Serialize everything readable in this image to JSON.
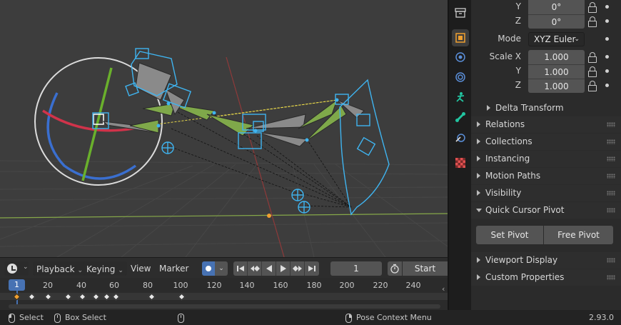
{
  "timeline": {
    "menus": {
      "playback": "Playback",
      "keying": "Keying",
      "view": "View",
      "marker": "Marker"
    },
    "current_frame": "1",
    "start_label": "Start",
    "frame_badge": "1",
    "ticks": [
      "20",
      "40",
      "60",
      "80",
      "100",
      "120",
      "140",
      "160",
      "180",
      "200",
      "220",
      "240"
    ]
  },
  "statusbar": {
    "select": "Select",
    "box_select": "Box Select",
    "pose_context_menu": "Pose Context Menu",
    "version": "2.93.0"
  },
  "properties": {
    "rotation": {
      "y_label": "Y",
      "y_value": "0°",
      "z_label": "Z",
      "z_value": "0°"
    },
    "mode_label": "Mode",
    "mode_value": "XYZ Euler",
    "scale": {
      "x_label": "Scale X",
      "x_value": "1.000",
      "y_label": "Y",
      "y_value": "1.000",
      "z_label": "Z",
      "z_value": "1.000"
    },
    "delta_transform": "Delta Transform",
    "sections": {
      "relations": "Relations",
      "collections": "Collections",
      "instancing": "Instancing",
      "motion_paths": "Motion Paths",
      "visibility": "Visibility",
      "quick_cursor_pivot": "Quick Cursor Pivot",
      "viewport_display": "Viewport Display",
      "custom_properties": "Custom Properties"
    },
    "buttons": {
      "set_pivot": "Set Pivot",
      "free_pivot": "Free Pivot"
    }
  },
  "colors": {
    "accent_blue": "#4772b3",
    "bone_green": "#7fa84a",
    "bone_outline": "#3fb4f0",
    "axis_red": "#b03a3a",
    "gizmo_green": "#6ab02c",
    "gizmo_blue": "#3a6fd0",
    "gizmo_red": "#d0334a"
  }
}
